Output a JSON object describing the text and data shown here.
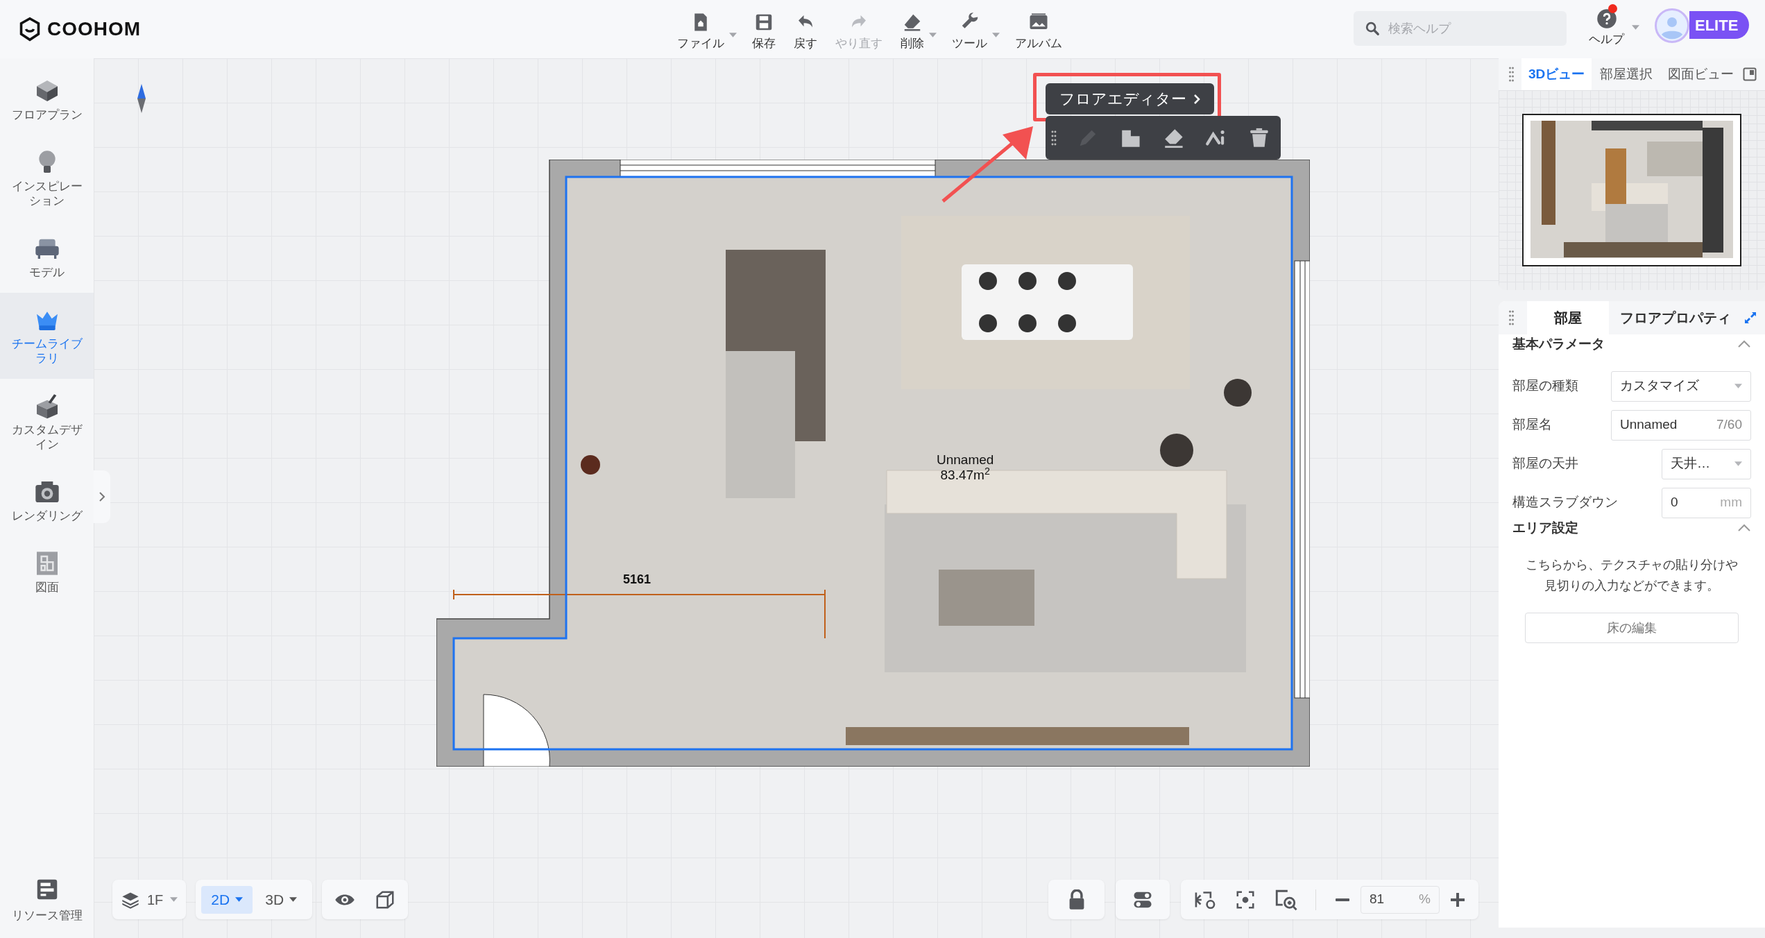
{
  "app": {
    "logo": "COOHOM"
  },
  "toolbar": [
    {
      "label": "ファイル",
      "dropdown": true,
      "disabled": false
    },
    {
      "label": "保存",
      "dropdown": false,
      "disabled": false
    },
    {
      "label": "戻す",
      "dropdown": false,
      "disabled": false
    },
    {
      "label": "やり直す",
      "dropdown": false,
      "disabled": true
    },
    {
      "label": "削除",
      "dropdown": true,
      "disabled": false
    },
    {
      "label": "ツール",
      "dropdown": true,
      "disabled": false
    },
    {
      "label": "アルバム",
      "dropdown": false,
      "disabled": false
    }
  ],
  "search": {
    "placeholder": "検索ヘルプ"
  },
  "help": {
    "label": "ヘルプ",
    "notification": true
  },
  "account": {
    "badge": "ELITE"
  },
  "sidebar": {
    "items": [
      {
        "label": "フロアプラン",
        "selected": false
      },
      {
        "label": "インスピレーション",
        "selected": false
      },
      {
        "label": "モデル",
        "selected": false
      },
      {
        "label": "チームライブラリ",
        "selected": true
      },
      {
        "label": "カスタムデザイン",
        "selected": false
      },
      {
        "label": "レンダリング",
        "selected": false
      },
      {
        "label": "図面",
        "selected": false
      }
    ],
    "bottom_item": {
      "label": "リソース管理"
    }
  },
  "canvas": {
    "floor_editor_button": "フロアエディター",
    "floor_tools": [
      {
        "disabled": true
      },
      {
        "disabled": false
      },
      {
        "disabled": false
      },
      {
        "disabled": false
      },
      {
        "disabled": false
      }
    ],
    "room": {
      "name": "Unnamed",
      "area": "83.47m$^{2}$"
    },
    "dimension": "5161"
  },
  "bottom_bar": {
    "floor": "1F",
    "view_modes": [
      {
        "label": "2D",
        "selected": true
      },
      {
        "label": "3D",
        "selected": false
      }
    ],
    "zoom": "81",
    "zoom_unit": "%"
  },
  "view_panel": {
    "tabs": [
      {
        "label": "3Dビュー",
        "selected": true
      },
      {
        "label": "部屋選択",
        "selected": false
      },
      {
        "label": "図面ビュー",
        "selected": false
      }
    ]
  },
  "properties": {
    "tabs": [
      {
        "label": "部屋",
        "selected": true
      },
      {
        "label": "フロアプロパティ",
        "selected": false
      }
    ],
    "sections": [
      {
        "title": "基本パラメータ",
        "expanded": true,
        "fields": [
          {
            "kind": "select",
            "label": "部屋の種類",
            "value": "カスタマイズ"
          },
          {
            "kind": "text",
            "label": "部屋名",
            "value": "Unnamed",
            "counter": "7/60"
          },
          {
            "kind": "select",
            "label": "部屋の天井",
            "value": "天井…"
          },
          {
            "kind": "number",
            "label": "構造スラブダウン",
            "value": "0",
            "unit": "mm"
          }
        ]
      },
      {
        "title": "エリア設定",
        "expanded": true,
        "description": "こちらから、テクスチャの貼り分けや見切りの入力などができます。",
        "button": "床の編集"
      }
    ]
  }
}
